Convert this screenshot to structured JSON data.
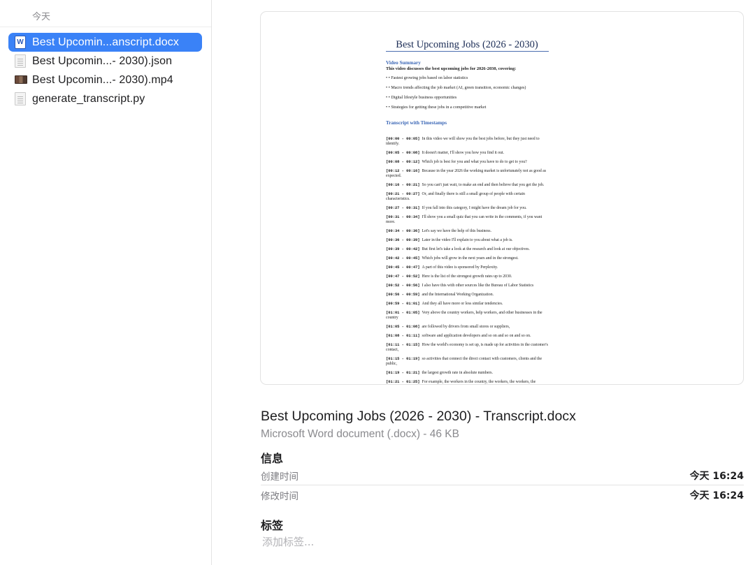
{
  "sidebar": {
    "section_header": "今天",
    "files": [
      {
        "name": "Best Upcomin...anscript.docx",
        "icon": "word-document-icon",
        "selected": true
      },
      {
        "name": "Best Upcomin...- 2030).json",
        "icon": "json-file-icon",
        "selected": false
      },
      {
        "name": "Best Upcomin...- 2030).mp4",
        "icon": "video-file-icon",
        "selected": false
      },
      {
        "name": "generate_transcript.py",
        "icon": "python-file-icon",
        "selected": false
      }
    ]
  },
  "preview": {
    "doc_title": "Best Upcoming Jobs (2026 - 2030)",
    "summary_heading": "Video Summary",
    "summary_intro": "This video discusses the best upcoming jobs for 2026-2030, covering:",
    "bullets": [
      "• • Fastest growing jobs based on labor statistics",
      "• • Macro trends affecting the job market (AI, green transition, economic changes)",
      "• • Digital lifestyle business opportunities",
      "• • Strategies for getting these jobs in a competitive market"
    ],
    "transcript_heading": "Transcript with Timestamps",
    "entries": [
      {
        "ts": "[00:00 - 00:05]",
        "text": "In this video we will show you the best jobs before, but they just need to identify."
      },
      {
        "ts": "[00:05 - 00:08]",
        "text": "It doesn't matter, I'll show you how you find it out."
      },
      {
        "ts": "[00:08 - 00:12]",
        "text": "Which job is best for you and what you have to do to get to you?"
      },
      {
        "ts": "[00:12 - 00:16]",
        "text": "Because in the year 2026 the working market is unfortunately not as good as expected."
      },
      {
        "ts": "[00:16 - 00:21]",
        "text": "So you can't just wait, to make an end and then believe that you get the job."
      },
      {
        "ts": "[00:21 - 00:27]",
        "text": "Or, and finally there is still a small group of people with certain characteristics."
      },
      {
        "ts": "[00:27 - 00:31]",
        "text": "If you fall into this category, I might have the dream job for you."
      },
      {
        "ts": "[00:31 - 00:34]",
        "text": "I'll show you a small quiz that you can write in the comments, if you want more."
      },
      {
        "ts": "[00:34 - 00:36]",
        "text": "Let's say we have the help of this business."
      },
      {
        "ts": "[00:36 - 00:39]",
        "text": "Later in the video I'll explain to you about what a job is."
      },
      {
        "ts": "[00:39 - 00:42]",
        "text": "But first let's take a look at the research and look at our objectives."
      },
      {
        "ts": "[00:42 - 00:45]",
        "text": "Which jobs will grow in the next years and in the strongest."
      },
      {
        "ts": "[00:45 - 00:47]",
        "text": "A part of this video is sponsored by Perplexity."
      },
      {
        "ts": "[00:47 - 00:52]",
        "text": "Here is the list of the strongest growth rates up to 2030."
      },
      {
        "ts": "[00:52 - 00:56]",
        "text": "I also have this with other sources like the Bureau of Labor Statistics"
      },
      {
        "ts": "[00:56 - 00:59]",
        "text": "and the International Working Organization."
      },
      {
        "ts": "[00:59 - 01:01]",
        "text": "And they all have more or less similar tendencies."
      },
      {
        "ts": "[01:01 - 01:05]",
        "text": "Very above the country workers, help workers, and other businesses in the country"
      },
      {
        "ts": "[01:05 - 01:08]",
        "text": "are followed by drivers from small stores or suppliers,"
      },
      {
        "ts": "[01:08 - 01:11]",
        "text": "software and application developers and so on and so on and so on."
      },
      {
        "ts": "[01:11 - 01:15]",
        "text": "How the world's economy is set up, is made up for activities in the customer's contact,"
      },
      {
        "ts": "[01:15 - 01:19]",
        "text": "so activities that connect the direct contact with customers, clients and the public,"
      },
      {
        "ts": "[01:19 - 01:21]",
        "text": "the largest growth rate in absolute numbers."
      },
      {
        "ts": "[01:21 - 01:25]",
        "text": "For example, the workers in the country, the workers, the workers, the workers, the workers,"
      }
    ]
  },
  "details": {
    "title": "Best Upcoming Jobs (2026 - 2030) - Transcript.docx",
    "subtitle": "Microsoft Word document (.docx) - 46 KB",
    "info_heading": "信息",
    "created_label": "创建时间",
    "created_value": "今天 16:24",
    "modified_label": "修改时间",
    "modified_value": "今天 16:24",
    "tags_heading": "标签",
    "tags_placeholder": "添加标签..."
  },
  "colors": {
    "selection": "#3a82f7",
    "doc_heading": "#3a66b6",
    "secondary_text": "#8a8a8e"
  }
}
